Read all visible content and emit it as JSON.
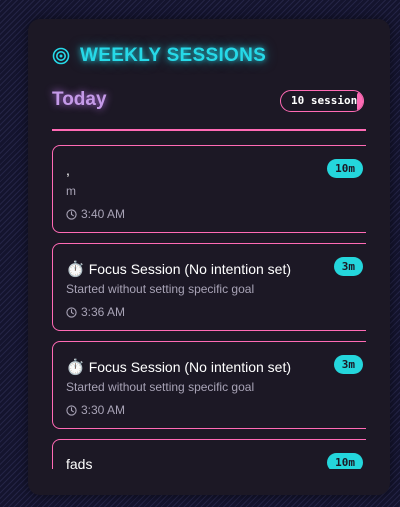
{
  "header": {
    "title": "WEEKLY SESSIONS",
    "icon": "target-icon"
  },
  "day": {
    "label": "Today",
    "session_count": "10 sessions"
  },
  "colors": {
    "accent_cyan": "#26d9e8",
    "accent_pink": "#ff6ab5",
    "accent_purple": "#c49ae8",
    "panel": "#1c1825"
  },
  "sessions": [
    {
      "emoji": "",
      "title": ",",
      "description": "m",
      "time": "3:40 AM",
      "duration": "10m"
    },
    {
      "emoji": "⏱️",
      "title": "Focus Session (No intention set)",
      "description": "Started without setting specific goal",
      "time": "3:36 AM",
      "duration": "3m"
    },
    {
      "emoji": "⏱️",
      "title": "Focus Session (No intention set)",
      "description": "Started without setting specific goal",
      "time": "3:30 AM",
      "duration": "3m"
    },
    {
      "emoji": "",
      "title": "fads",
      "description": "",
      "time": "",
      "duration": "10m"
    }
  ]
}
